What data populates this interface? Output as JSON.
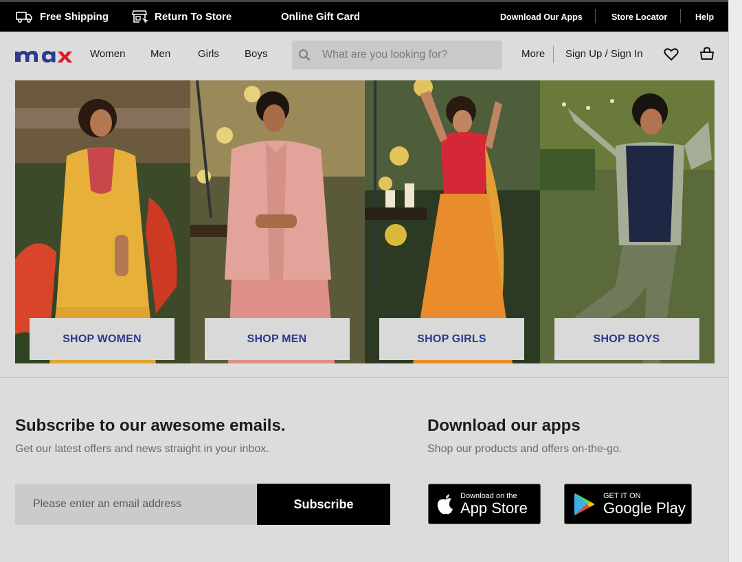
{
  "topbar": {
    "free_shipping": "Free Shipping",
    "return_to_store": "Return To Store",
    "gift_card": "Online Gift Card",
    "download_apps": "Download Our Apps",
    "store_locator": "Store Locator",
    "help": "Help"
  },
  "header": {
    "logo": "max",
    "nav": [
      "Women",
      "Men",
      "Girls",
      "Boys"
    ],
    "search_placeholder": "What are you looking for?",
    "more": "More",
    "sign_in": "Sign Up / Sign In"
  },
  "banners": [
    {
      "label": "SHOP WOMEN"
    },
    {
      "label": "SHOP MEN"
    },
    {
      "label": "SHOP GIRLS"
    },
    {
      "label": "SHOP BOYS"
    }
  ],
  "subscribe": {
    "title": "Subscribe to our awesome emails.",
    "text": "Get our latest offers and news straight in your inbox.",
    "email_placeholder": "Please enter an email address",
    "button": "Subscribe"
  },
  "apps": {
    "title": "Download our apps",
    "text": "Shop our products and offers on-the-go.",
    "app_store_small": "Download on the",
    "app_store_big": "App Store",
    "google_small": "GET IT ON",
    "google_big": "Google Play"
  },
  "colors": {
    "brand": "#2b3a8f",
    "logo_accent": "#e0192a",
    "topbar": "#000000"
  }
}
